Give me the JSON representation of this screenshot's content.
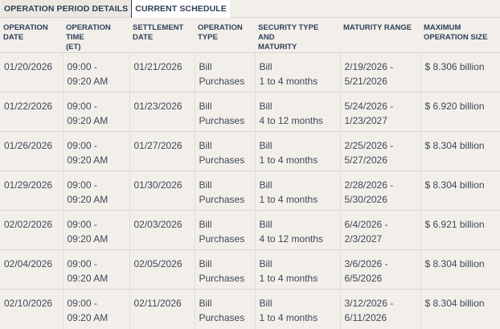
{
  "tabs": {
    "period_details": "OPERATION PERIOD DETAILS",
    "current_schedule": "CURRENT SCHEDULE"
  },
  "table": {
    "headers": [
      [
        "OPERATION",
        "DATE"
      ],
      [
        "OPERATION TIME",
        "(ET)"
      ],
      [
        "SETTLEMENT",
        "DATE"
      ],
      [
        "OPERATION",
        "TYPE"
      ],
      [
        "SECURITY TYPE AND",
        "MATURITY"
      ],
      [
        "MATURITY RANGE",
        ""
      ],
      [
        "MAXIMUM",
        "OPERATION SIZE"
      ]
    ],
    "rows": [
      {
        "op_date": "01/20/2026",
        "time_1": "09:00 -",
        "time_2": "09:20 AM",
        "settle": "01/21/2026",
        "type_1": "Bill",
        "type_2": "Purchases",
        "sec_1": "Bill",
        "sec_2": "1 to 4 months",
        "range_1": "2/19/2026 -",
        "range_2": "5/21/2026",
        "size": "$ 8.306 billion"
      },
      {
        "op_date": "01/22/2026",
        "time_1": "09:00 -",
        "time_2": "09:20 AM",
        "settle": "01/23/2026",
        "type_1": "Bill",
        "type_2": "Purchases",
        "sec_1": "Bill",
        "sec_2": "4 to 12 months",
        "range_1": "5/24/2026 -",
        "range_2": "1/23/2027",
        "size": "$ 6.920 billion"
      },
      {
        "op_date": "01/26/2026",
        "time_1": "09:00 -",
        "time_2": "09:20 AM",
        "settle": "01/27/2026",
        "type_1": "Bill",
        "type_2": "Purchases",
        "sec_1": "Bill",
        "sec_2": "1 to 4 months",
        "range_1": "2/25/2026 -",
        "range_2": "5/27/2026",
        "size": "$ 8.304 billion"
      },
      {
        "op_date": "01/29/2026",
        "time_1": "09:00 -",
        "time_2": "09:20 AM",
        "settle": "01/30/2026",
        "type_1": "Bill",
        "type_2": "Purchases",
        "sec_1": "Bill",
        "sec_2": "1 to 4 months",
        "range_1": "2/28/2026 -",
        "range_2": "5/30/2026",
        "size": "$ 8.304 billion"
      },
      {
        "op_date": "02/02/2026",
        "time_1": "09:00 -",
        "time_2": "09:20 AM",
        "settle": "02/03/2026",
        "type_1": "Bill",
        "type_2": "Purchases",
        "sec_1": "Bill",
        "sec_2": "4 to 12 months",
        "range_1": "6/4/2026 -",
        "range_2": "2/3/2027",
        "size": "$ 6.921 billion"
      },
      {
        "op_date": "02/04/2026",
        "time_1": "09:00 -",
        "time_2": "09:20 AM",
        "settle": "02/05/2026",
        "type_1": "Bill",
        "type_2": "Purchases",
        "sec_1": "Bill",
        "sec_2": "1 to 4 months",
        "range_1": "3/6/2026 -",
        "range_2": "6/5/2026",
        "size": "$ 8.304 billion"
      },
      {
        "op_date": "02/10/2026",
        "time_1": "09:00 -",
        "time_2": "09:20 AM",
        "settle": "02/11/2026",
        "type_1": "Bill",
        "type_2": "Purchases",
        "sec_1": "Bill",
        "sec_2": "1 to 4 months",
        "range_1": "3/12/2026 -",
        "range_2": "6/11/2026",
        "size": "$ 8.304 billion"
      }
    ]
  }
}
